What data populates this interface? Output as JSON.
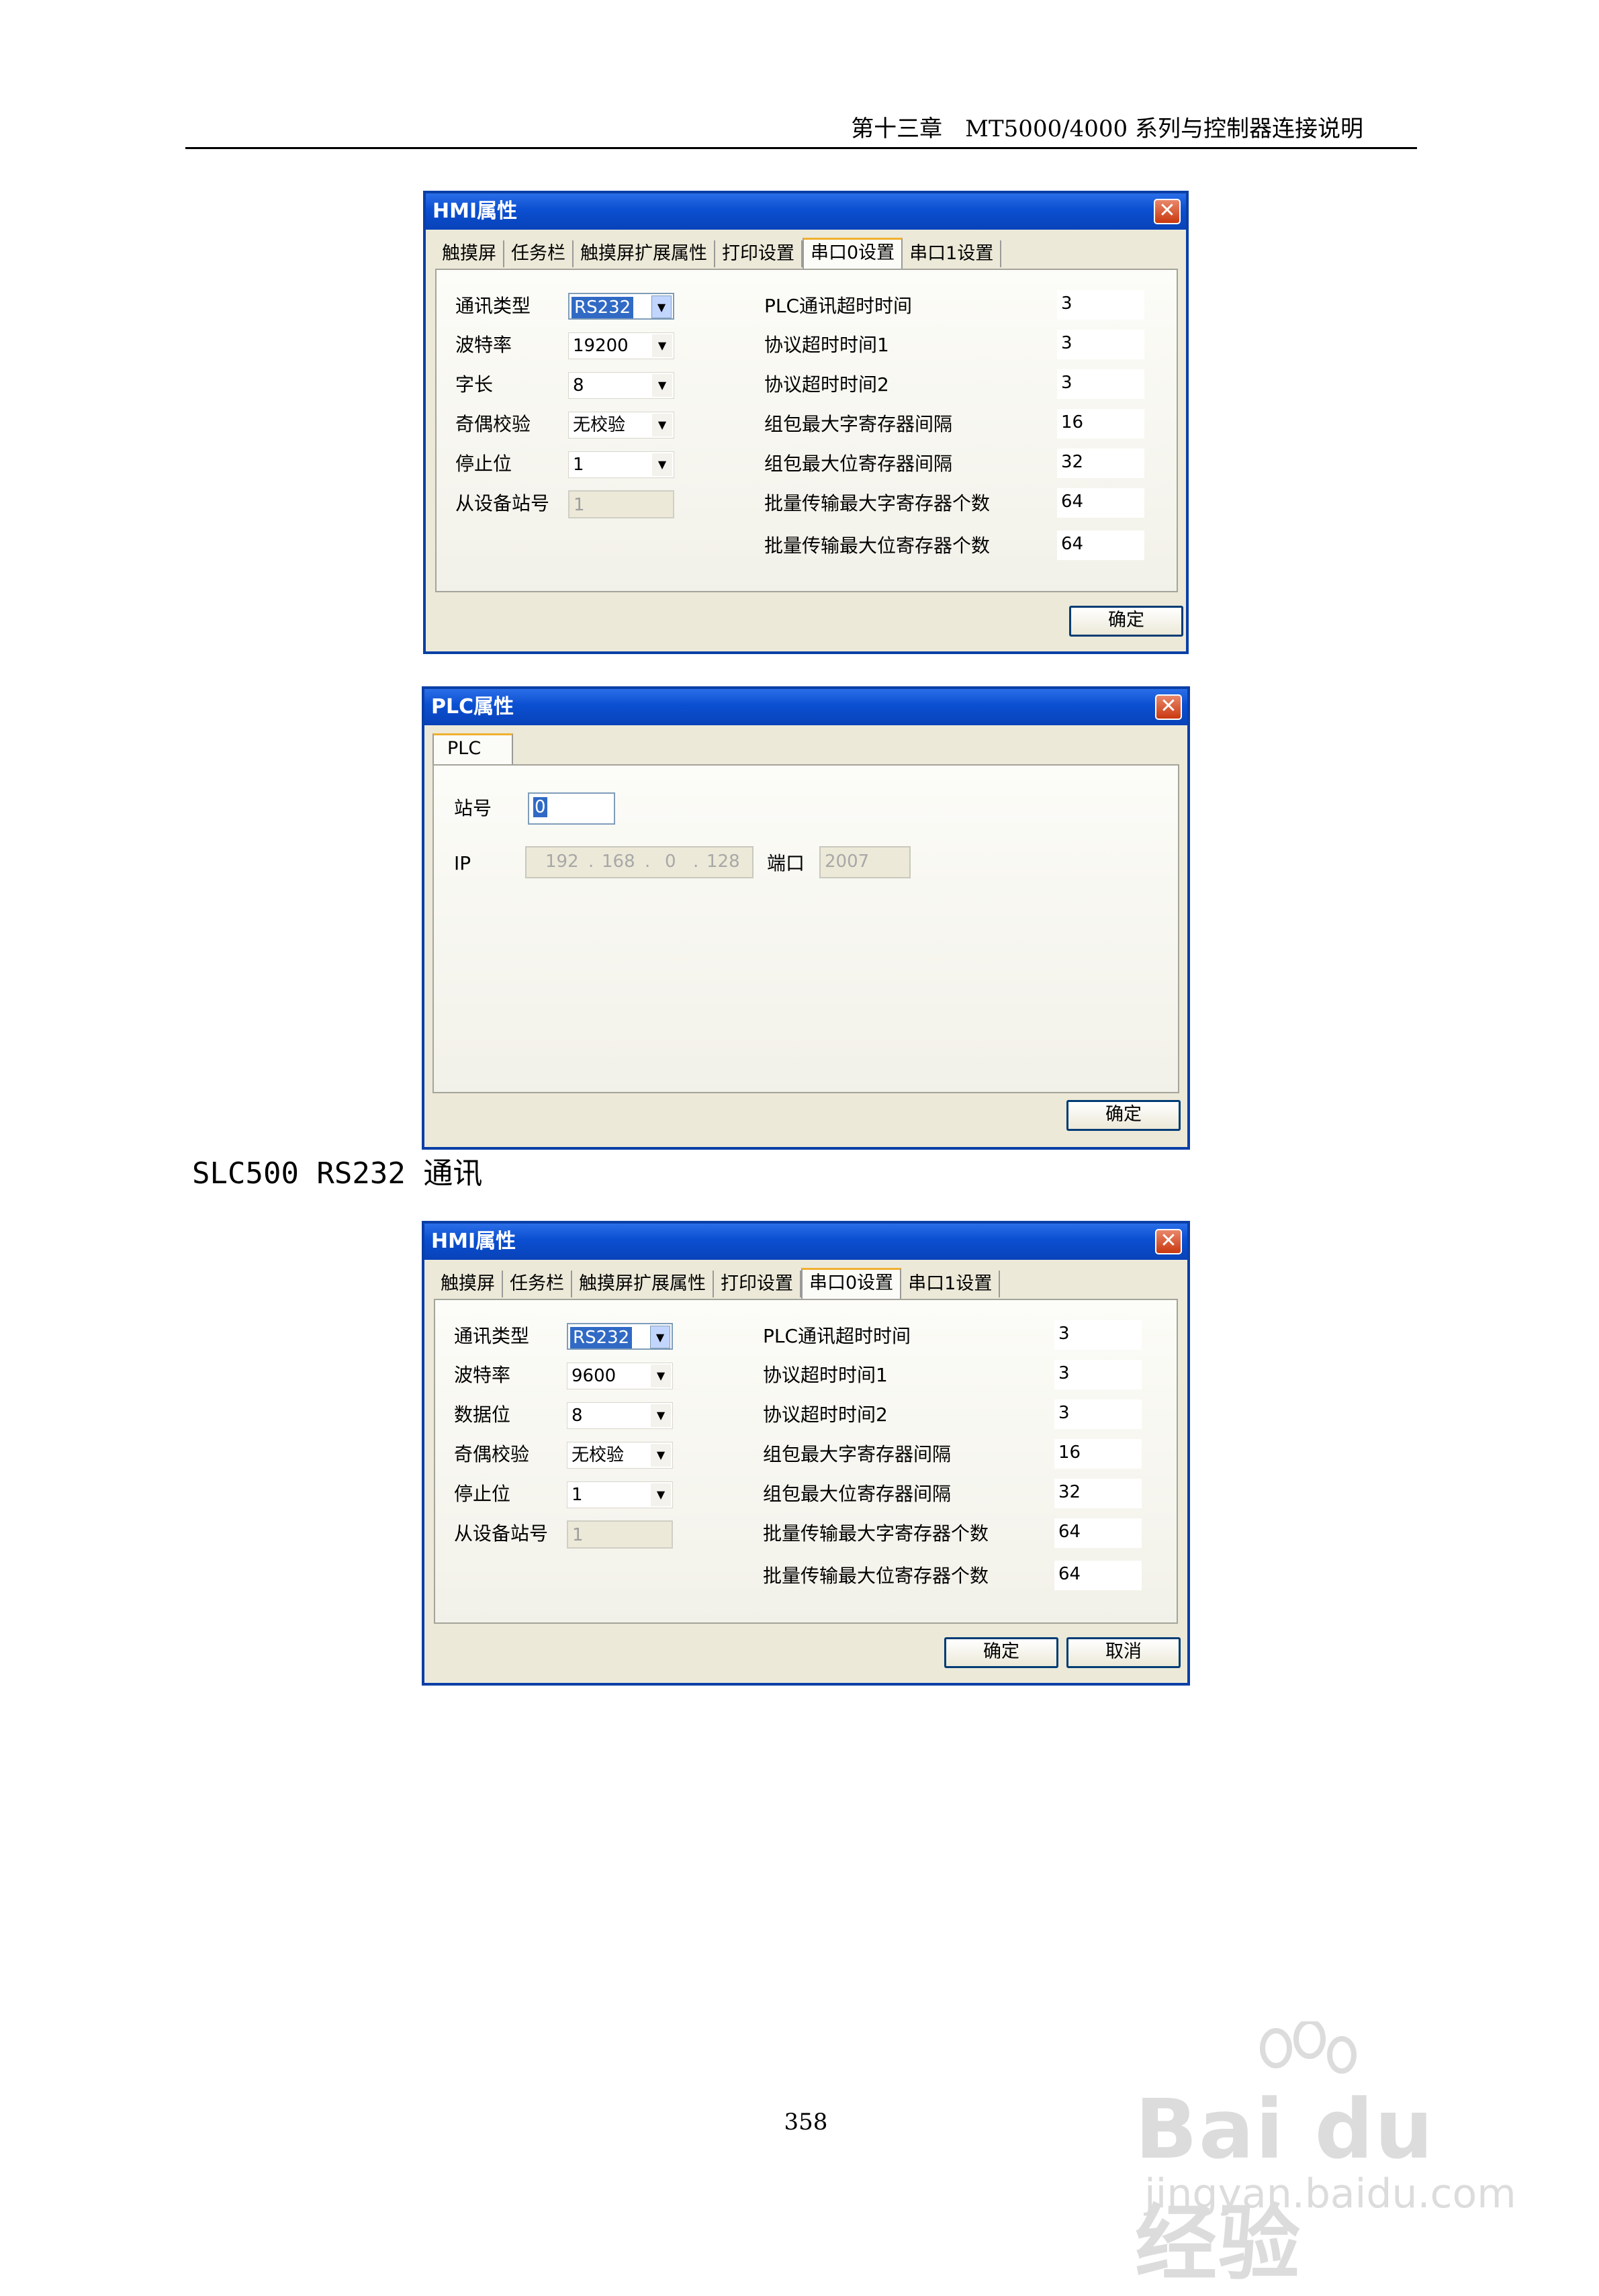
{
  "header": {
    "text": "第十三章　MT5000/4000 系列与控制器连接说明"
  },
  "dialog1": {
    "title": "HMI属性",
    "tabs": [
      "触摸屏",
      "任务栏",
      "触摸屏扩展属性",
      "打印设置",
      "串口0设置",
      "串口1设置"
    ],
    "active_tab": "串口0设置",
    "left_fields": [
      {
        "label": "通讯类型",
        "value": "RS232"
      },
      {
        "label": "波特率",
        "value": "19200"
      },
      {
        "label": "字长",
        "value": "8"
      },
      {
        "label": "奇偶校验",
        "value": "无校验"
      },
      {
        "label": "停止位",
        "value": "1"
      },
      {
        "label": "从设备站号",
        "value": "1"
      }
    ],
    "right_fields": [
      {
        "label": "PLC通讯超时时间",
        "value": "3"
      },
      {
        "label": "协议超时时间1",
        "value": "3"
      },
      {
        "label": "协议超时时间2",
        "value": "3"
      },
      {
        "label": "组包最大字寄存器间隔",
        "value": "16"
      },
      {
        "label": "组包最大位寄存器间隔",
        "value": "32"
      },
      {
        "label": "批量传输最大字寄存器个数",
        "value": "64"
      },
      {
        "label": "批量传输最大位寄存器个数",
        "value": "64"
      }
    ],
    "ok_label": "确定"
  },
  "dialog2": {
    "title": "PLC属性",
    "tab": "PLC",
    "station_label": "站号",
    "station_value": "0",
    "ip_label": "IP",
    "ip_parts": [
      "192",
      "168",
      "0",
      "128"
    ],
    "port_label": "端口",
    "port_value": "2007",
    "ok_label": "确定"
  },
  "section_title": "SLC500 RS232 通讯",
  "dialog3": {
    "title": "HMI属性",
    "tabs": [
      "触摸屏",
      "任务栏",
      "触摸屏扩展属性",
      "打印设置",
      "串口0设置",
      "串口1设置"
    ],
    "active_tab": "串口0设置",
    "left_fields": [
      {
        "label": "通讯类型",
        "value": "RS232"
      },
      {
        "label": "波特率",
        "value": "9600"
      },
      {
        "label": "数据位",
        "value": "8"
      },
      {
        "label": "奇偶校验",
        "value": "无校验"
      },
      {
        "label": "停止位",
        "value": "1"
      },
      {
        "label": "从设备站号",
        "value": "1"
      }
    ],
    "right_fields": [
      {
        "label": "PLC通讯超时时间",
        "value": "3"
      },
      {
        "label": "协议超时时间1",
        "value": "3"
      },
      {
        "label": "协议超时时间2",
        "value": "3"
      },
      {
        "label": "组包最大字寄存器间隔",
        "value": "16"
      },
      {
        "label": "组包最大位寄存器间隔",
        "value": "32"
      },
      {
        "label": "批量传输最大字寄存器个数",
        "value": "64"
      },
      {
        "label": "批量传输最大位寄存器个数",
        "value": "64"
      }
    ],
    "ok_label": "确定",
    "cancel_label": "取消"
  },
  "page_number": "358",
  "watermark": {
    "brand": "Bai du 经验",
    "url": "jingyan.baidu.com"
  },
  "icons": {
    "close": "close-icon",
    "dropdown": "chevron-down-icon"
  }
}
